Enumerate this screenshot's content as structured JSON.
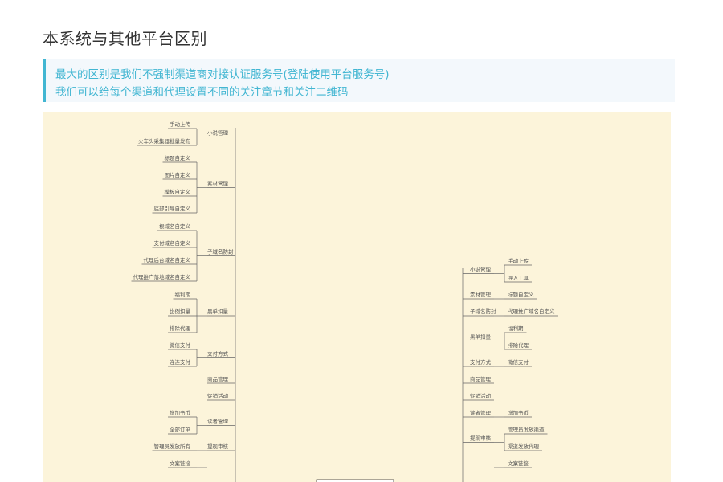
{
  "page": {
    "title": "本系统与其他平台区别",
    "note_lines": [
      "最大的区别是我们不强制渠道商对接认证服务号(登陆使用平台服务号)",
      "我们可以给每个渠道和代理设置不同的关注章节和关注二维码"
    ]
  },
  "colors": {
    "accent": "#42b6d2",
    "canvas": "#fcf4da",
    "line": "#666666"
  },
  "mindmap": {
    "left": [
      {
        "label": "小说管理",
        "children": [
          "手动上传",
          "火车头采集器批量发布"
        ]
      },
      {
        "label": "素材管理",
        "children": [
          "标题自定义",
          "图片自定义",
          "模板自定义",
          "底部引导自定义"
        ]
      },
      {
        "label": "子域名防封",
        "children": [
          "根域名自定义",
          "支付域名自定义",
          "代理后台域名自定义",
          "代理推广落地域名自定义"
        ]
      },
      {
        "label": "黑单扣量",
        "children": [
          "福利期",
          "比例扣量",
          "排除代理"
        ]
      },
      {
        "label": "支付方式",
        "children": [
          "微信支付",
          "连连支付"
        ]
      },
      {
        "label": "商品管理",
        "children": []
      },
      {
        "label": "促销活动",
        "children": []
      },
      {
        "label": "读者管理",
        "children": [
          "增加书币",
          "全部订单"
        ]
      },
      {
        "label": "提现审核",
        "children": [
          "管理员发放所有"
        ]
      },
      {
        "label": "",
        "children": [
          "文案链接"
        ]
      }
    ],
    "right": [
      {
        "label": "小说管理",
        "children": [
          "手动上传",
          "导入工具"
        ]
      },
      {
        "label": "素材管理",
        "children": [
          "标题自定义"
        ]
      },
      {
        "label": "子域名防封",
        "children": [
          "代理推广域名自定义"
        ]
      },
      {
        "label": "黑单扣量",
        "children": [
          "福利期",
          "排除代理"
        ]
      },
      {
        "label": "支付方式",
        "children": [
          "微信支付"
        ]
      },
      {
        "label": "商品管理",
        "children": []
      },
      {
        "label": "促销活动",
        "children": []
      },
      {
        "label": "读者管理",
        "children": [
          "增加书币"
        ]
      },
      {
        "label": "提现审核",
        "children": [
          "管理员发放渠道",
          "渠道发放代理"
        ]
      },
      {
        "label": "",
        "children": [
          "文案链接"
        ]
      }
    ]
  }
}
